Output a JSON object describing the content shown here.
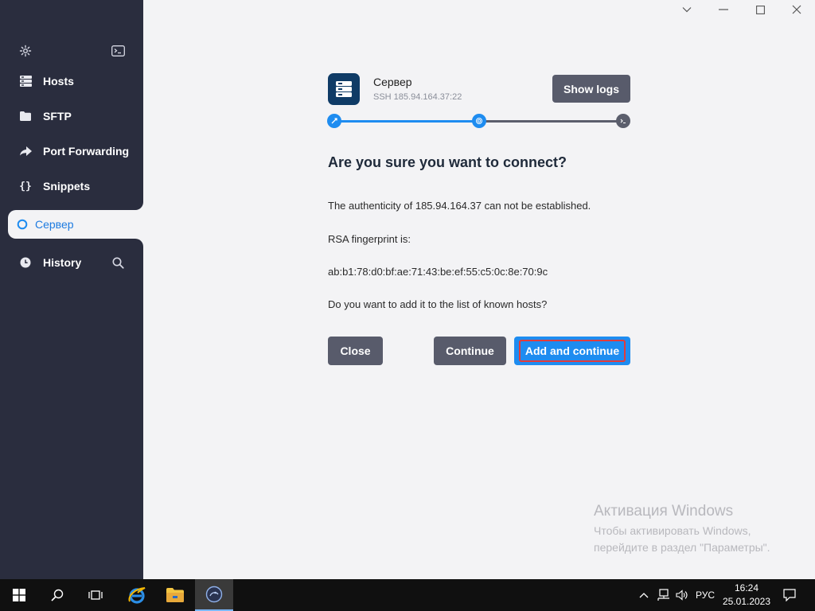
{
  "sidebar": {
    "items": [
      {
        "label": "Hosts"
      },
      {
        "label": "SFTP"
      },
      {
        "label": "Port Forwarding"
      },
      {
        "label": "Snippets"
      },
      {
        "label": "Сервер"
      },
      {
        "label": "History"
      }
    ]
  },
  "host": {
    "name": "Сервер",
    "address": "SSH 185.94.164.37:22"
  },
  "toolbar": {
    "show_logs_label": "Show logs"
  },
  "progress": {
    "value": 0.5
  },
  "dialog": {
    "title": "Are you sure you want to connect?",
    "line1": "The authenticity of 185.94.164.37 can not be established.",
    "line2": "RSA fingerprint is:",
    "fingerprint": "ab:b1:78:d0:bf:ae:71:43:be:ef:55:c5:0c:8e:70:9c",
    "question": "Do you want to add it to the list of known hosts?",
    "close_label": "Close",
    "continue_label": "Continue",
    "add_continue_label": "Add and continue"
  },
  "watermark": {
    "title": "Активация Windows",
    "body": "Чтобы активировать Windows, перейдите в раздел \"Параметры\"."
  },
  "taskbar": {
    "lang": "РУС",
    "time": "16:24",
    "date": "25.01.2023"
  },
  "colors": {
    "sidebar": "#2a2d3e",
    "accent": "#1e8cf0",
    "host_icon": "#0f3b66",
    "button_gray": "#585b6b",
    "focus_ring": "#e23b3b"
  }
}
